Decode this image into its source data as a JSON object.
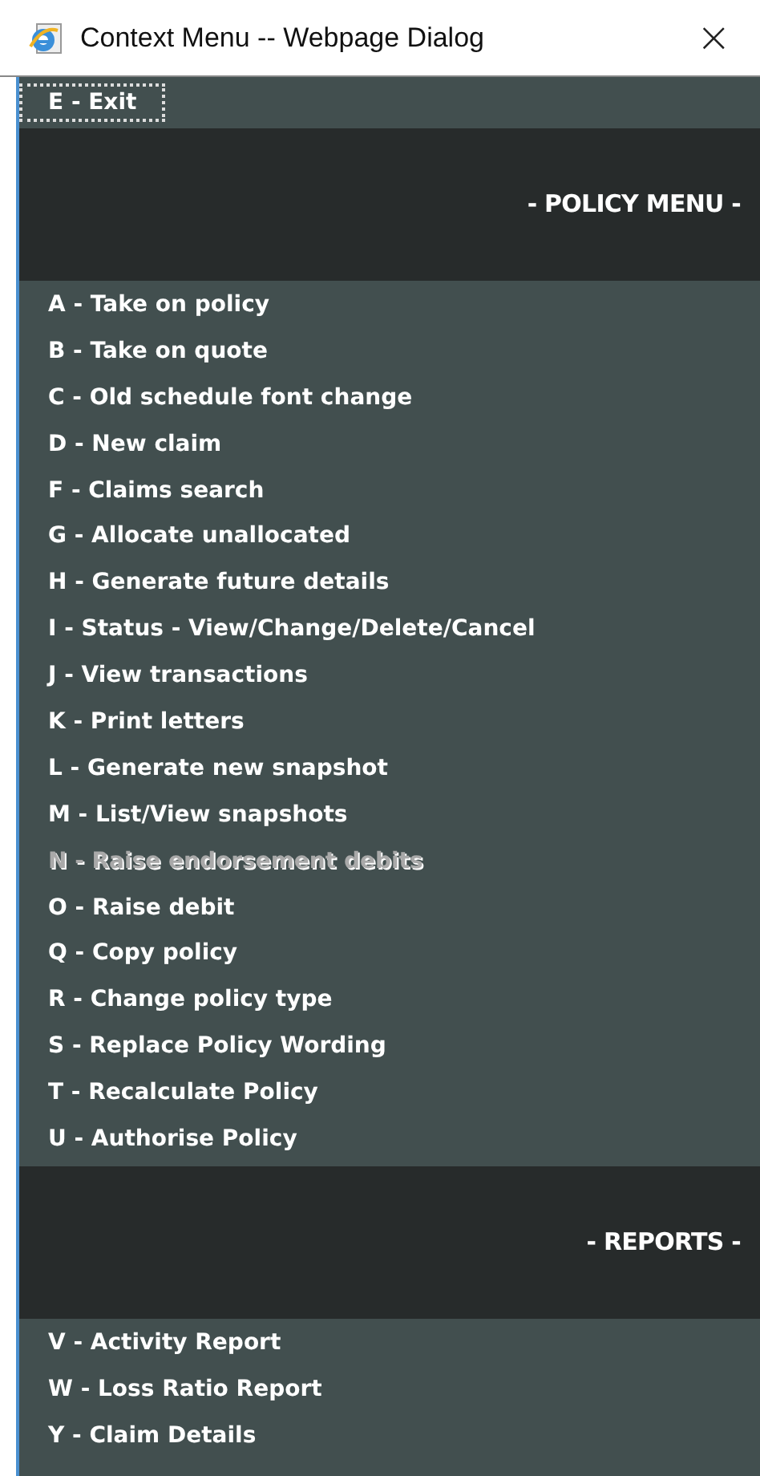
{
  "window": {
    "title": "Context Menu -- Webpage Dialog",
    "close": "×"
  },
  "exit": {
    "text": "E - Exit",
    "focused": true
  },
  "sections": [
    {
      "title": "- POLICY MENU -",
      "items": [
        {
          "text": "**A** - Take on policy",
          "disabled": false
        },
        {
          "text": "**B** - Take on quote",
          "disabled": false
        },
        {
          "text": "**C** - Old schedule font change",
          "disabled": false
        },
        {
          "text": "**D** - New claim",
          "disabled": false
        },
        {
          "text": "**F** - Claims search",
          "disabled": false
        },
        {
          "text": "**G** - Allocate unallocated",
          "disabled": false
        },
        {
          "text": "**H** - Generate future details",
          "disabled": false
        },
        {
          "text": "**I** - Status - View/Change/Delete/Cancel",
          "disabled": false
        },
        {
          "text": "**J** - View transactions",
          "disabled": false
        },
        {
          "text": "**K** - Print letters",
          "disabled": false
        },
        {
          "text": "**L** - Generate new snapshot",
          "disabled": false
        },
        {
          "text": "**M** - List/View snapshots",
          "disabled": false
        },
        {
          "text": "**N** - Raise endorsement debits",
          "disabled": true
        },
        {
          "text": "**O** - Raise debit",
          "disabled": false
        },
        {
          "text": "**Q** - Copy policy",
          "disabled": false
        },
        {
          "text": "**R** - Change policy type",
          "disabled": false
        },
        {
          "text": "**S** - Replace Policy Wording",
          "disabled": false
        },
        {
          "text": "**T** - Recalculate Policy",
          "disabled": false
        },
        {
          "text": "**U** - Authorise Policy",
          "disabled": false
        }
      ]
    },
    {
      "title": "- REPORTS -",
      "items": [
        {
          "text": "**V** - Activity Report",
          "disabled": false
        },
        {
          "text": "**W** - Loss Ratio Report",
          "disabled": false
        },
        {
          "text": "**Y** - Claim Details",
          "disabled": false
        }
      ]
    }
  ]
}
